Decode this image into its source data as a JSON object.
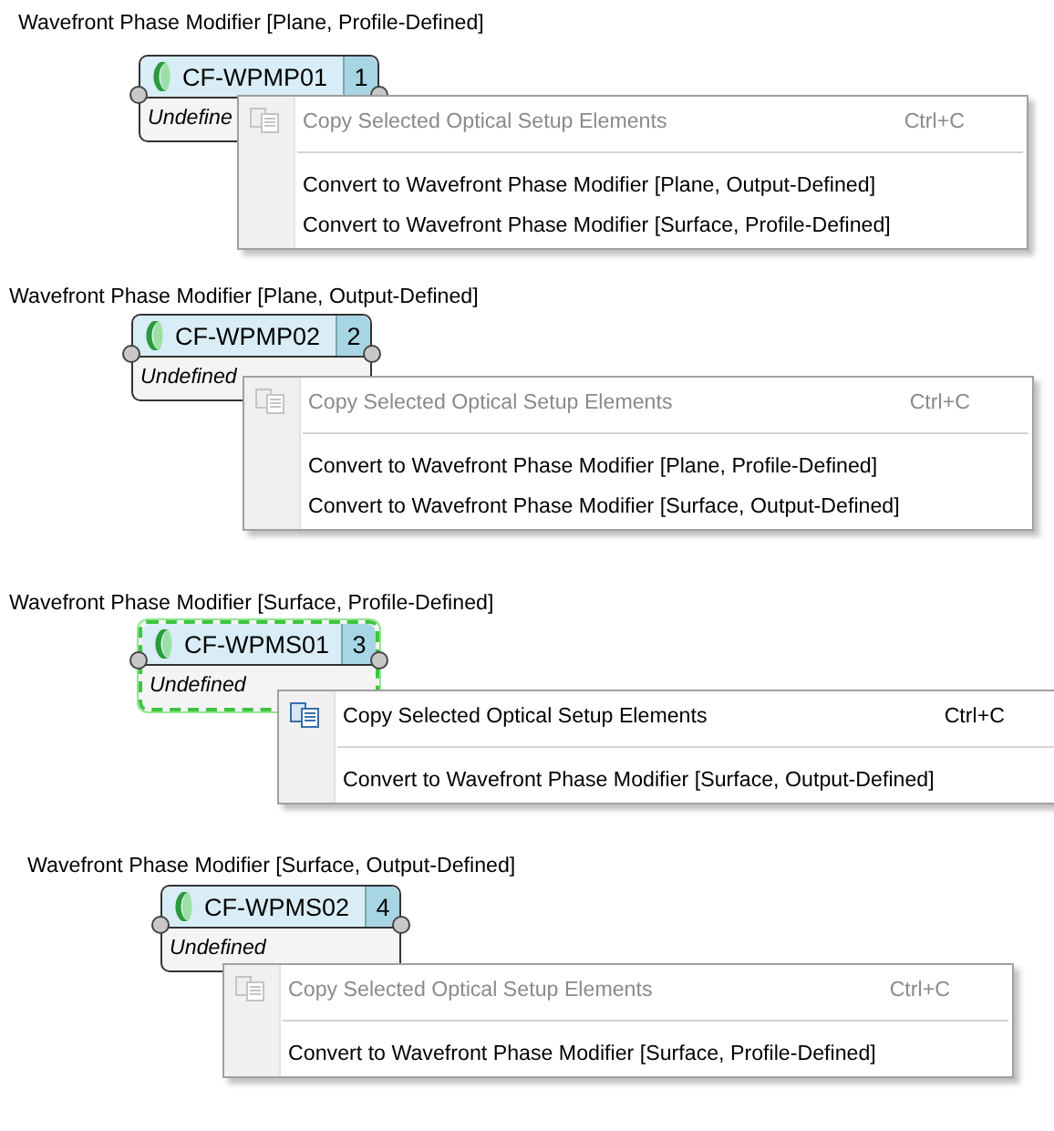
{
  "sections": [
    {
      "caption": "Wavefront Phase Modifier [Plane, Profile-Defined]",
      "node": {
        "name": "CF-WPMP01",
        "number": "1",
        "value": "Undefine",
        "selected": false
      },
      "menu": {
        "copy": {
          "label": "Copy Selected Optical Setup Elements",
          "shortcut": "Ctrl+C",
          "disabled": true
        },
        "converts": [
          "Convert to Wavefront Phase Modifier [Plane, Output-Defined]",
          "Convert to Wavefront Phase Modifier [Surface, Profile-Defined]"
        ]
      }
    },
    {
      "caption": "Wavefront Phase Modifier [Plane, Output-Defined]",
      "node": {
        "name": "CF-WPMP02",
        "number": "2",
        "value": "Undefined",
        "selected": false
      },
      "menu": {
        "copy": {
          "label": "Copy Selected Optical Setup Elements",
          "shortcut": "Ctrl+C",
          "disabled": true
        },
        "converts": [
          "Convert to Wavefront Phase Modifier [Plane, Profile-Defined]",
          "Convert to Wavefront Phase Modifier [Surface, Output-Defined]"
        ]
      }
    },
    {
      "caption": "Wavefront Phase Modifier [Surface, Profile-Defined]",
      "node": {
        "name": "CF-WPMS01",
        "number": "3",
        "value": "Undefined",
        "selected": true
      },
      "menu": {
        "copy": {
          "label": "Copy Selected Optical Setup Elements",
          "shortcut": "Ctrl+C",
          "disabled": false
        },
        "converts": [
          "Convert to Wavefront Phase Modifier [Surface, Output-Defined]"
        ]
      }
    },
    {
      "caption": "Wavefront Phase Modifier [Surface, Output-Defined]",
      "node": {
        "name": "CF-WPMS02",
        "number": "4",
        "value": "Undefined",
        "selected": false
      },
      "menu": {
        "copy": {
          "label": "Copy Selected Optical Setup Elements",
          "shortcut": "Ctrl+C",
          "disabled": true
        },
        "converts": [
          "Convert to Wavefront Phase Modifier [Surface, Profile-Defined]"
        ]
      }
    }
  ]
}
